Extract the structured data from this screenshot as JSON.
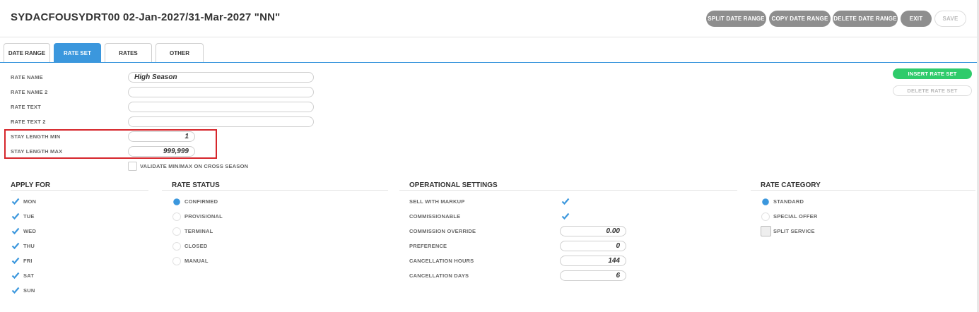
{
  "window": {
    "title": "SYDACFOUSYDRT00 02-Jan-2027/31-Mar-2027 \"NN\""
  },
  "toolbar": {
    "split": "SPLIT DATE RANGE",
    "copy": "COPY DATE RANGE",
    "delete": "DELETE DATE RANGE",
    "exit": "EXIT",
    "save": "SAVE"
  },
  "tabs": [
    {
      "label": "DATE RANGE",
      "active": false
    },
    {
      "label": "RATE SET",
      "active": true
    },
    {
      "label": "RATES",
      "active": false
    },
    {
      "label": "OTHER",
      "active": false
    }
  ],
  "form": {
    "rate_name": {
      "label": "RATE NAME",
      "value": "High Season"
    },
    "rate_name_2": {
      "label": "RATE NAME 2",
      "value": ""
    },
    "rate_text": {
      "label": "RATE TEXT",
      "value": ""
    },
    "rate_text_2": {
      "label": "RATE TEXT 2",
      "value": ""
    },
    "stay_min": {
      "label": "STAY LENGTH MIN",
      "value": "1"
    },
    "stay_max": {
      "label": "STAY LENGTH MAX",
      "value": "999,999"
    },
    "validate": {
      "label": "VALIDATE MIN/MAX ON CROSS SEASON",
      "checked": false
    }
  },
  "side": {
    "insert": "INSERT RATE SET",
    "delete": "DELETE RATE SET"
  },
  "apply_for": {
    "heading": "APPLY FOR",
    "days": [
      {
        "label": "MON",
        "checked": true
      },
      {
        "label": "TUE",
        "checked": true
      },
      {
        "label": "WED",
        "checked": true
      },
      {
        "label": "THU",
        "checked": true
      },
      {
        "label": "FRI",
        "checked": true
      },
      {
        "label": "SAT",
        "checked": true
      },
      {
        "label": "SUN",
        "checked": true
      }
    ]
  },
  "rate_status": {
    "heading": "RATE STATUS",
    "options": [
      {
        "label": "CONFIRMED",
        "selected": true
      },
      {
        "label": "PROVISIONAL",
        "selected": false
      },
      {
        "label": "TERMINAL",
        "selected": false
      },
      {
        "label": "CLOSED",
        "selected": false
      },
      {
        "label": "MANUAL",
        "selected": false
      }
    ]
  },
  "operational": {
    "heading": "OPERATIONAL SETTINGS",
    "sell_with_markup": {
      "label": "SELL WITH MARKUP",
      "checked": true
    },
    "commissionable": {
      "label": "COMMISSIONABLE",
      "checked": true
    },
    "commission_override": {
      "label": "COMMISSION OVERRIDE",
      "value": "0.00"
    },
    "preference": {
      "label": "PREFERENCE",
      "value": "0"
    },
    "cancellation_hours": {
      "label": "CANCELLATION HOURS",
      "value": "144"
    },
    "cancellation_days": {
      "label": "CANCELLATION DAYS",
      "value": "6"
    }
  },
  "rate_category": {
    "heading": "RATE CATEGORY",
    "standard": {
      "label": "STANDARD",
      "selected": true
    },
    "special_offer": {
      "label": "SPECIAL OFFER",
      "selected": false
    },
    "split_service": {
      "label": "SPLIT SERVICE",
      "checked": false
    }
  },
  "colors": {
    "accent": "#3b97dd",
    "green": "#2fcb6b",
    "highlight": "#d6262b"
  }
}
